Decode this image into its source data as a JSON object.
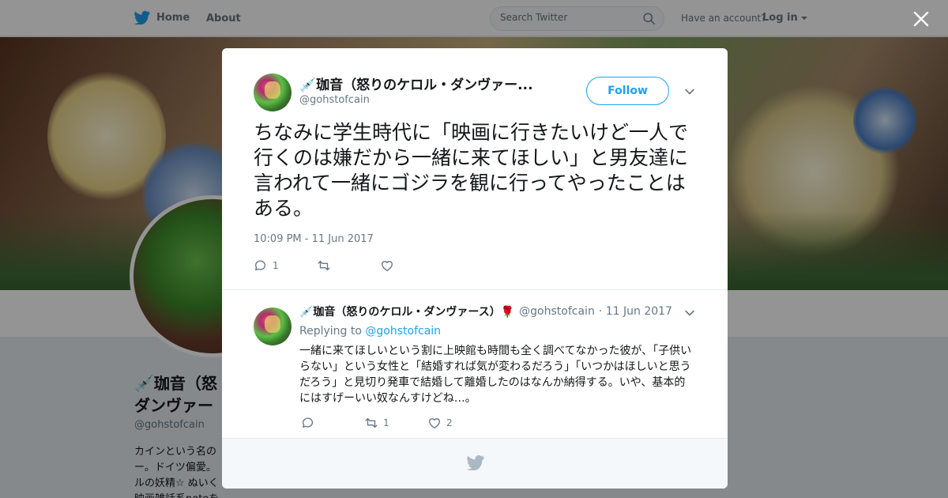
{
  "nav": {
    "home_label": "Home",
    "about_label": "About",
    "search_placeholder": "Search Twitter",
    "have_account": "Have an account?",
    "login_label": "Log in"
  },
  "profile_bg": {
    "name_line1": "💉珈音（怒",
    "name_line2": "ダンヴァー",
    "handle": "@gohstofcain",
    "bio": "カインという名の ー。ドイツ偏愛。 ルの妖精☆ ぬいく 映画雑話系noteをやってます"
  },
  "tweet": {
    "display_name": "💉珈音（怒りのケロル・ダンヴァー...",
    "handle": "@gohstofcain",
    "follow_label": "Follow",
    "text": "ちなみに学生時代に「映画に行きたいけど一人で行くのは嫌だから一緒に来てほしい」と男友達に言われて一緒にゴジラを観に行ってやったことはある。",
    "timestamp": "10:09 PM - 11 Jun 2017",
    "reply_count": "1",
    "retweet_count": "",
    "like_count": ""
  },
  "reply": {
    "display_name": "💉珈音（怒りのケロル・ダンヴァース）🌹",
    "handle": "@gohstofcain",
    "date": "· 11 Jun 2017",
    "replying_prefix": "Replying to",
    "replying_mention": "@gohstofcain",
    "text": "一緒に来てほしいという割に上映館も時間も全く調べてなかった彼が、「子供いらない」という女性と「結婚すれば気が変わるだろう」「いつかはほしいと思うだろう」と見切り発車で結婚して離婚したのはなんか納得する。いや、基本的にはすげーいい奴なんすけどね…。",
    "reply_count": "",
    "retweet_count": "1",
    "like_count": "2"
  },
  "colors": {
    "accent": "#1da1f2",
    "muted": "#657786",
    "text": "#14171a"
  }
}
